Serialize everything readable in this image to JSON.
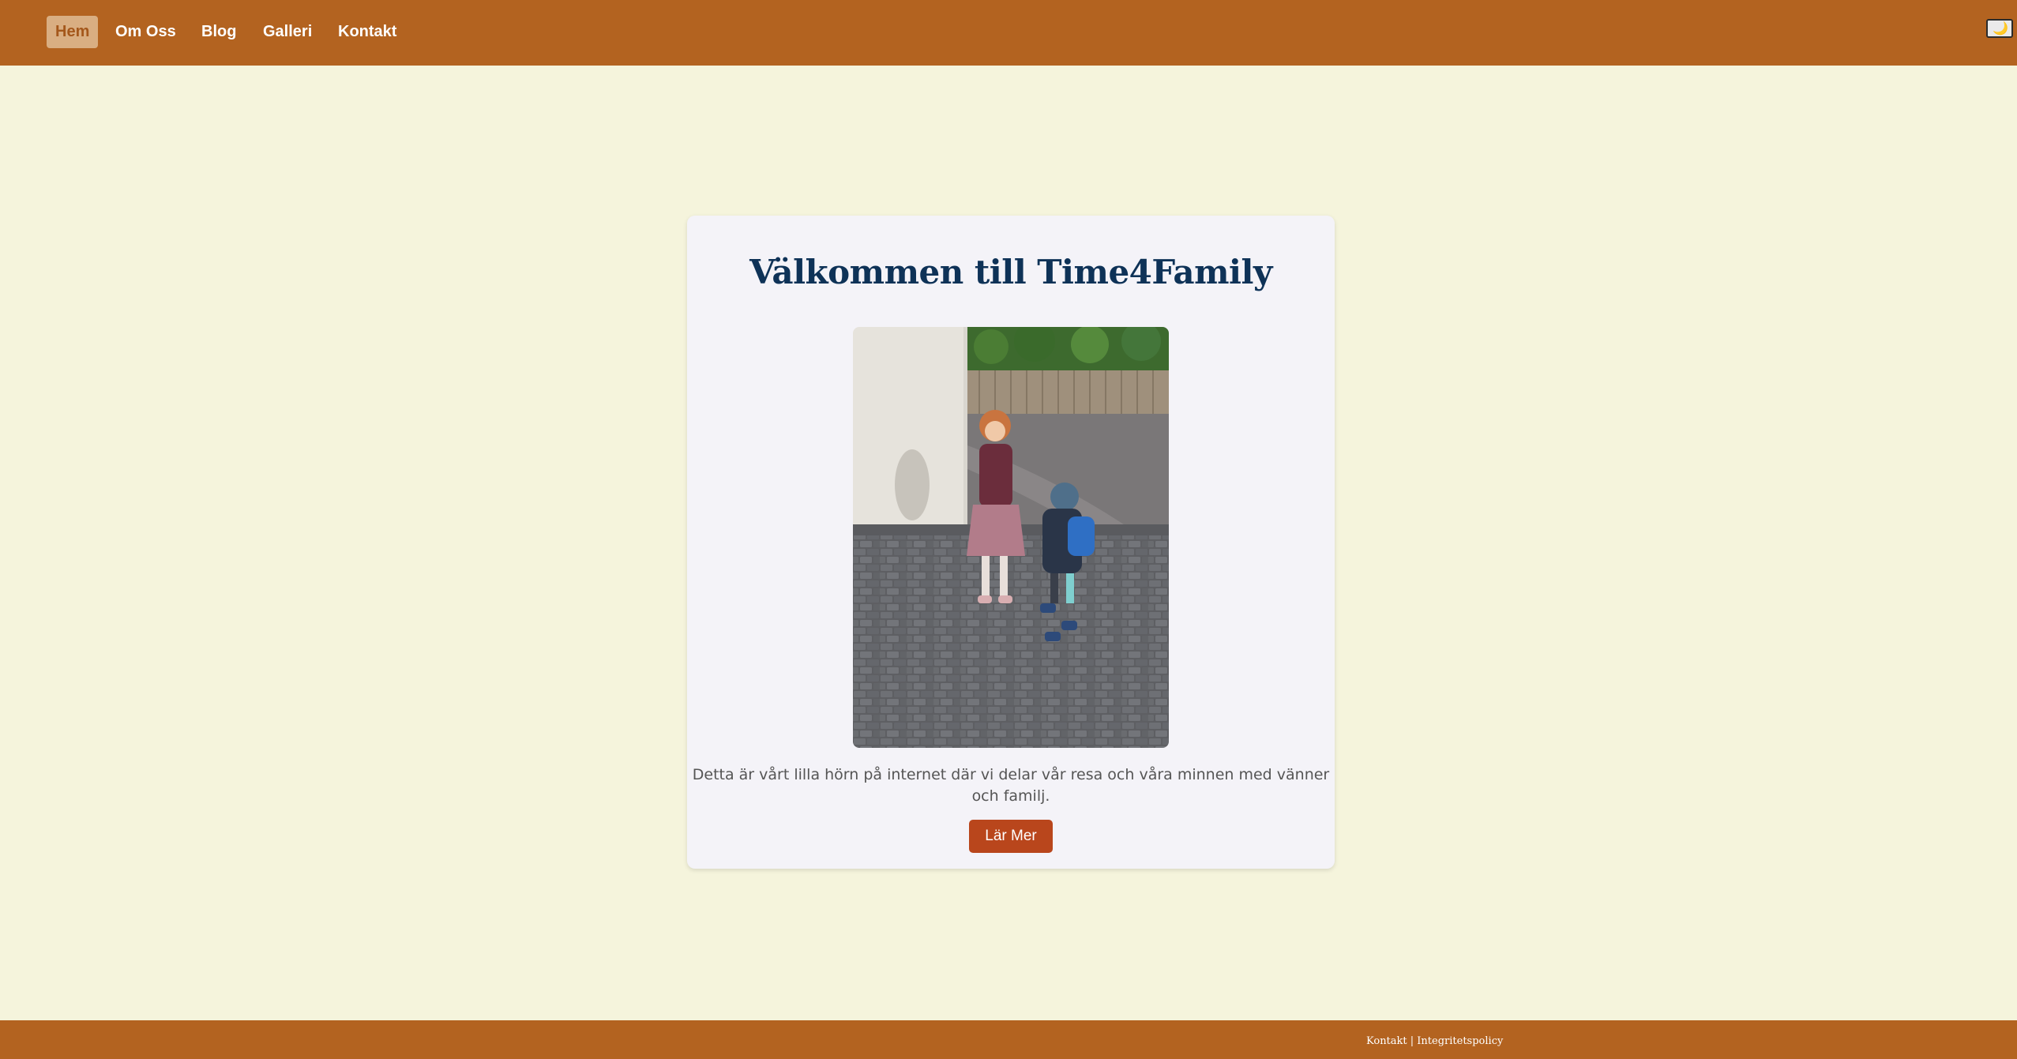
{
  "nav": {
    "items": [
      {
        "label": "Hem",
        "active": true
      },
      {
        "label": "Om Oss"
      },
      {
        "label": "Blog"
      },
      {
        "label": "Galleri"
      },
      {
        "label": "Kontakt"
      }
    ],
    "theme_toggle_icon": "moon-icon",
    "theme_toggle_glyph": "🌙"
  },
  "hero": {
    "title": "Välkommen till Time4Family",
    "image_subject": "family-photo",
    "text": "Detta är vårt lilla hörn på internet där vi delar vår resa och våra minnen med vänner och familj.",
    "button_label": "Lär Mer"
  },
  "footer": {
    "links": [
      "Kontakt",
      "Integritetspolicy"
    ],
    "separator": " | "
  },
  "colors": {
    "header_bg": "#b36320",
    "page_bg": "#f5f4dc",
    "card_bg": "#f4f3f8",
    "title": "#0e3257",
    "button_bg": "#b9461c",
    "active_nav_bg": "#d9ae82"
  }
}
